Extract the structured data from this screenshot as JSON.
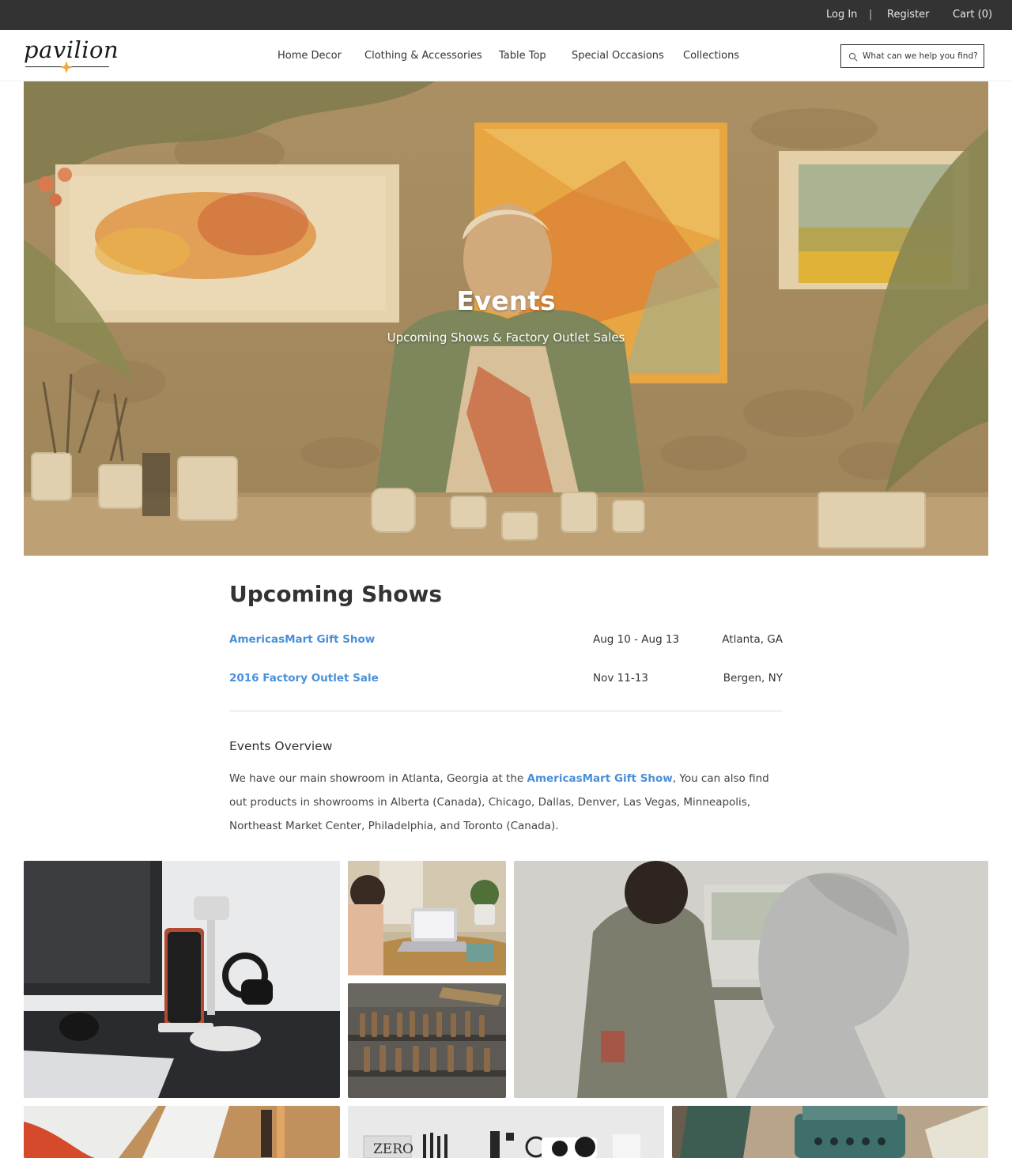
{
  "topbar": {
    "login": "Log In",
    "separator": "|",
    "register": "Register",
    "cart": "Cart (0)"
  },
  "header": {
    "logo_text": "pavilion",
    "nav": [
      "Home Decor",
      "Clothing & Accessories",
      "Table Top",
      "Special Occasions",
      "Collections"
    ],
    "search_placeholder": "What can we help you find?"
  },
  "hero": {
    "title": "Events",
    "subtitle": "Upcoming Shows & Factory Outlet Sales"
  },
  "shows": {
    "heading": "Upcoming Shows",
    "items": [
      {
        "name": "AmericasMart Gift Show",
        "dates": "Aug 10 - Aug 13",
        "location": "Atlanta, GA"
      },
      {
        "name": "2016 Factory Outlet Sale",
        "dates": "Nov 11-13",
        "location": "Bergen, NY"
      }
    ]
  },
  "overview": {
    "heading": "Events Overview",
    "text_before": "We have our main showroom in Atlanta, Georgia at the ",
    "link": "AmericasMart Gift Show",
    "text_after": ", You can also find out products in showrooms in Alberta (Canada), Chicago, Dallas, Denver, Las Vegas, Minneapolis, Northeast Market Center, Philadelphia, and Toronto (Canada)."
  },
  "gallery": {
    "sign_text": "ZERO"
  },
  "colors": {
    "topbar_bg": "#333333",
    "link_blue": "#4a90d9",
    "logo_star": "#f2a93b",
    "hero_tint": "#d4a85e"
  }
}
